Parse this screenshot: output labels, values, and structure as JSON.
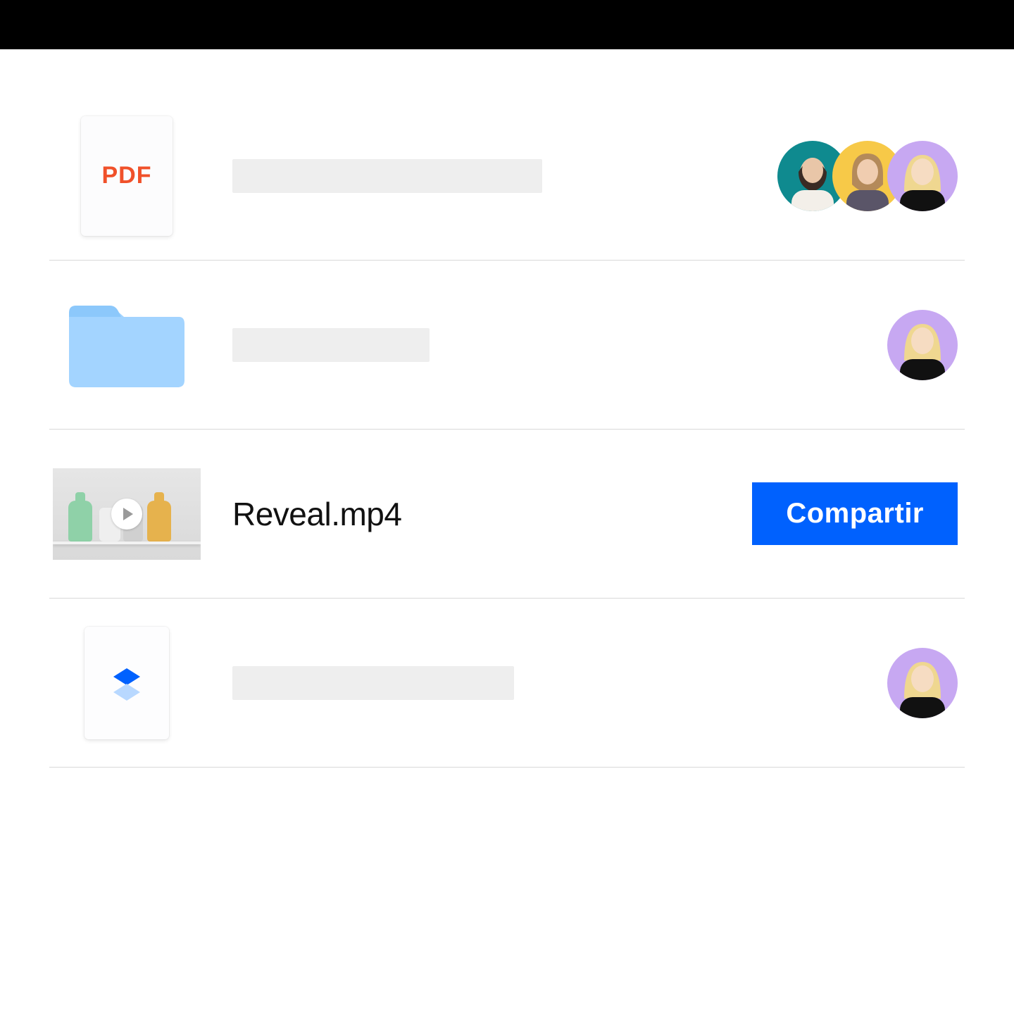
{
  "rows": [
    {
      "type": "pdf",
      "icon_label": "PDF",
      "name": null,
      "name_placeholder_width": 440,
      "share_button": null,
      "avatars": [
        {
          "bg": "#0f8a8f"
        },
        {
          "bg": "#f7c948"
        },
        {
          "bg": "#c7a8f2"
        }
      ]
    },
    {
      "type": "folder",
      "name": null,
      "name_placeholder_width": 280,
      "share_button": null,
      "avatars": [
        {
          "bg": "#c7a8f2"
        }
      ]
    },
    {
      "type": "video",
      "name": "Reveal.mp4",
      "name_placeholder_width": 0,
      "share_button": "Compartir",
      "avatars": []
    },
    {
      "type": "dropbox-file",
      "name": null,
      "name_placeholder_width": 400,
      "share_button": null,
      "avatars": [
        {
          "bg": "#c7a8f2"
        }
      ]
    }
  ],
  "colors": {
    "pdf_label": "#f0512a",
    "folder": "#a3d4ff",
    "share_button_bg": "#0061fe",
    "share_button_text": "#ffffff"
  }
}
